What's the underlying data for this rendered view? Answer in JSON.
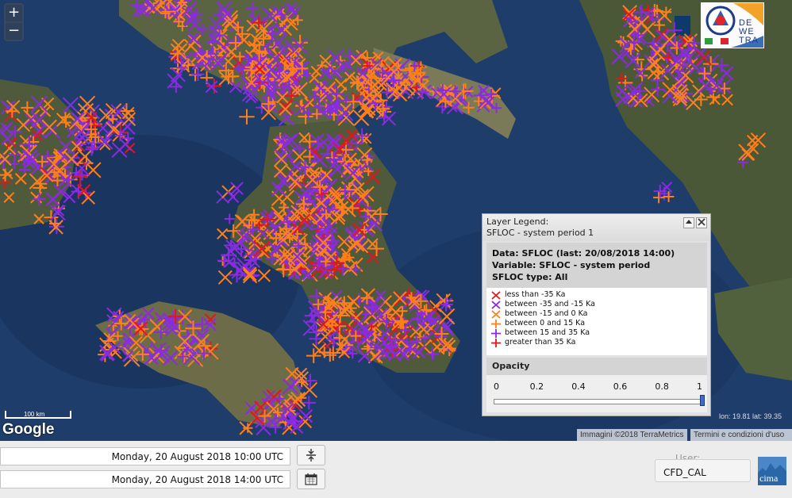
{
  "map": {
    "zoom_in_label": "+",
    "zoom_out_label": "−",
    "google_label": "Google",
    "scale_label": "100 km",
    "coords": "lon: 19.81 lat: 39.35",
    "attribution_imagery": "Immagini ©2018 TerraMetrics",
    "attribution_terms": "Termini e condizioni d'uso",
    "logo_text": [
      "DE",
      "WE",
      "TRA"
    ],
    "colors": {
      "sea": "#1f3d6b",
      "land": "#5f6a45",
      "orange": "#ff7f1a",
      "purple": "#8a2be2",
      "red": "#e4161b"
    }
  },
  "legend": {
    "title_line1": "Layer Legend:",
    "title_line2": "SFLOC - system period 1",
    "collapse_icon": "collapse-up-icon",
    "close_icon": "close-icon",
    "data_line": "Data: SFLOC (last: 20/08/2018 14:00)",
    "variable_line": "Variable: SFLOC - system period",
    "type_line": "SFLOC type: All",
    "items": [
      {
        "label": "less than -35 Ka",
        "marker": "x",
        "color": "#e4161b"
      },
      {
        "label": "between -35 and -15 Ka",
        "marker": "x",
        "color": "#8a2be2"
      },
      {
        "label": "between -15 and 0 Ka",
        "marker": "x",
        "color": "#ff7f1a"
      },
      {
        "label": "between 0 and 15 Ka",
        "marker": "+",
        "color": "#ff7f1a"
      },
      {
        "label": "between 15 and 35 Ka",
        "marker": "+",
        "color": "#8a2be2"
      },
      {
        "label": "greater than 35 Ka",
        "marker": "+",
        "color": "#e4161b"
      }
    ],
    "opacity_title": "Opacity",
    "opacity_ticks": [
      "0",
      "0.2",
      "0.4",
      "0.6",
      "0.8",
      "1"
    ],
    "opacity_value": 1.0
  },
  "bottom": {
    "date_from": "Monday, 20 August 2018 10:00 UTC",
    "date_to": "Monday, 20 August 2018 14:00 UTC",
    "range_icon": "expand-vertical-icon",
    "calendar_icon": "calendar-icon",
    "user_label": "User:",
    "user_value": "CFD_CAL",
    "cima_label": "cima"
  }
}
